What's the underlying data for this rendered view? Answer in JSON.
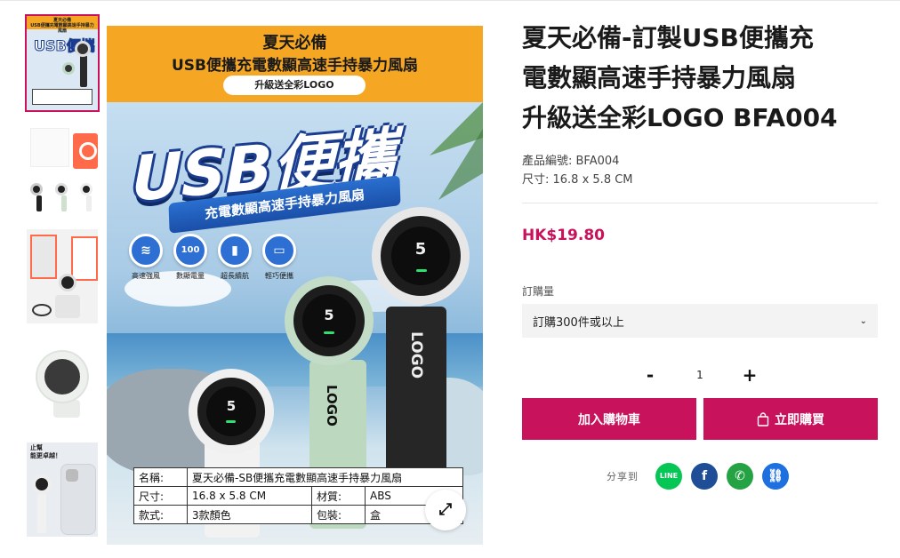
{
  "thumbnails": {
    "t1_title": "夏天必備\nUSB便攜充電數顯高速手持暴力風扇",
    "t1_usb": "USB便攜",
    "t5_text": "止幫\n能更卓越！"
  },
  "main_image": {
    "banner_line1": "夏天必備",
    "banner_line2": "USB便攜充電數顯高速手持暴力風扇",
    "banner_pill": "升級送全彩LOGO",
    "usb_title": "USB便攜",
    "ribbon": "充電數顯高速手持暴力風扇",
    "features": [
      {
        "icon": "≋",
        "label": "高速強風"
      },
      {
        "icon": "100",
        "label": "數顯電量"
      },
      {
        "icon": "▮",
        "label": "超長續航"
      },
      {
        "icon": "▭",
        "label": "輕巧便攜"
      }
    ],
    "fan_digit": "5",
    "fan_logo": "LOGO",
    "spec": {
      "r1_k": "名稱:",
      "r1_v": "夏天必備-SB便攜充電數顯高速手持暴力風扇",
      "r2_k": "尺寸:",
      "r2_v": "16.8 x 5.8 CM",
      "r2_k2": "材質:",
      "r2_v2": "ABS",
      "r3_k": "款式:",
      "r3_v": "3款顏色",
      "r3_k2": "包裝:",
      "r3_v2": "盒"
    },
    "zoom_icon": "⤢"
  },
  "product": {
    "title_line1": "夏天必備-訂製USB便攜充",
    "title_line2": "電數顯高速手持暴力風扇",
    "title_line3": "升級送全彩LOGO BFA004",
    "code_label": "產品編號: BFA004",
    "size_label": "尺寸: 16.8 x 5.8 CM",
    "price": "HK$19.80",
    "qty_label": "訂購量",
    "qty_option": "訂購300件或以上",
    "qty_minus": "-",
    "qty_value": "1",
    "qty_plus": "+",
    "add_to_cart": "加入購物車",
    "buy_now": "立即購買",
    "share_label": "分享到"
  },
  "share_icons": [
    {
      "name": "line-icon",
      "glyph": "LINE",
      "color": "#06c755"
    },
    {
      "name": "facebook-icon",
      "glyph": "f",
      "color": "#1f4e96"
    },
    {
      "name": "whatsapp-icon",
      "glyph": "✆",
      "color": "#25a244"
    },
    {
      "name": "link-icon",
      "glyph": "⛓",
      "color": "#1e6fe0"
    }
  ],
  "colors": {
    "accent": "#c8125b",
    "banner": "#f5a623"
  }
}
